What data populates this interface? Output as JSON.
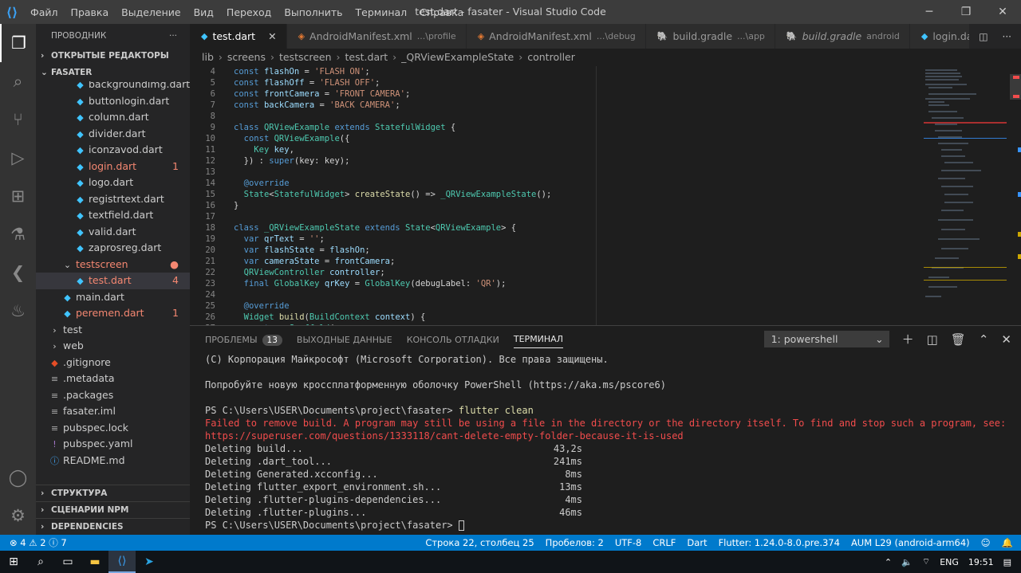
{
  "titlebar": {
    "menu": [
      "Файл",
      "Правка",
      "Выделение",
      "Вид",
      "Переход",
      "Выполнить",
      "Терминал",
      "Справка"
    ],
    "title": "test.dart - fasater - Visual Studio Code"
  },
  "sidebar": {
    "title": "ПРОВОДНИК",
    "open_editors": "ОТКРЫТЫЕ РЕДАКТОРЫ",
    "project": "FASATER",
    "files": [
      {
        "name": "backgroundimg.dart",
        "indent": 2,
        "icon": "dart",
        "err": false,
        "badge": ""
      },
      {
        "name": "buttonlogin.dart",
        "indent": 2,
        "icon": "dart",
        "err": false,
        "badge": ""
      },
      {
        "name": "column.dart",
        "indent": 2,
        "icon": "dart",
        "err": false,
        "badge": ""
      },
      {
        "name": "divider.dart",
        "indent": 2,
        "icon": "dart",
        "err": false,
        "badge": ""
      },
      {
        "name": "iconzavod.dart",
        "indent": 2,
        "icon": "dart",
        "err": false,
        "badge": ""
      },
      {
        "name": "login.dart",
        "indent": 2,
        "icon": "dart",
        "err": true,
        "badge": "1"
      },
      {
        "name": "logo.dart",
        "indent": 2,
        "icon": "dart",
        "err": false,
        "badge": ""
      },
      {
        "name": "registrtext.dart",
        "indent": 2,
        "icon": "dart",
        "err": false,
        "badge": ""
      },
      {
        "name": "textfield.dart",
        "indent": 2,
        "icon": "dart",
        "err": false,
        "badge": ""
      },
      {
        "name": "valid.dart",
        "indent": 2,
        "icon": "dart",
        "err": false,
        "badge": ""
      },
      {
        "name": "zaprosreg.dart",
        "indent": 2,
        "icon": "dart",
        "err": false,
        "badge": ""
      },
      {
        "name": "testscreen",
        "indent": 1,
        "icon": "folder-open",
        "err": true,
        "badge": "●"
      },
      {
        "name": "test.dart",
        "indent": 2,
        "icon": "dart",
        "err": true,
        "badge": "4"
      },
      {
        "name": "main.dart",
        "indent": 1,
        "icon": "dart",
        "err": false,
        "badge": ""
      },
      {
        "name": "peremen.dart",
        "indent": 1,
        "icon": "dart",
        "err": true,
        "badge": "1"
      },
      {
        "name": "test",
        "indent": 0,
        "icon": "folder",
        "err": false,
        "badge": ""
      },
      {
        "name": "web",
        "indent": 0,
        "icon": "folder",
        "err": false,
        "badge": ""
      },
      {
        "name": ".gitignore",
        "indent": 0,
        "icon": "git",
        "err": false,
        "badge": ""
      },
      {
        "name": ".metadata",
        "indent": 0,
        "icon": "text",
        "err": false,
        "badge": ""
      },
      {
        "name": ".packages",
        "indent": 0,
        "icon": "text",
        "err": false,
        "badge": ""
      },
      {
        "name": "fasater.iml",
        "indent": 0,
        "icon": "text",
        "err": false,
        "badge": ""
      },
      {
        "name": "pubspec.lock",
        "indent": 0,
        "icon": "text",
        "err": false,
        "badge": ""
      },
      {
        "name": "pubspec.yaml",
        "indent": 0,
        "icon": "yaml",
        "err": false,
        "badge": ""
      },
      {
        "name": "README.md",
        "indent": 0,
        "icon": "info",
        "err": false,
        "badge": ""
      }
    ],
    "bottom_sections": [
      "СТРУКТУРА",
      "СЦЕНАРИИ NPM",
      "DEPENDENCIES"
    ]
  },
  "tabs": [
    {
      "label": "test.dart",
      "sub": "",
      "active": true,
      "italic": false,
      "icon": "dart"
    },
    {
      "label": "AndroidManifest.xml",
      "sub": "...\\profile",
      "active": false,
      "italic": false,
      "icon": "xml"
    },
    {
      "label": "AndroidManifest.xml",
      "sub": "...\\debug",
      "active": false,
      "italic": false,
      "icon": "xml"
    },
    {
      "label": "build.gradle",
      "sub": "...\\app",
      "active": false,
      "italic": false,
      "icon": "gradle"
    },
    {
      "label": "build.gradle",
      "sub": "android",
      "active": false,
      "italic": true,
      "icon": "gradle"
    },
    {
      "label": "login.dart",
      "sub": "",
      "active": false,
      "italic": false,
      "icon": "dart"
    }
  ],
  "breadcrumbs": [
    "lib",
    "screens",
    "testscreen",
    "test.dart",
    "_QRViewExampleState",
    "controller"
  ],
  "code": [
    {
      "n": "4",
      "html": "<span class='k'>const</span> <span class='v'>flashOn</span> = <span class='s'>'FLASH ON'</span>;"
    },
    {
      "n": "5",
      "html": "<span class='k'>const</span> <span class='v'>flashOff</span> = <span class='s'>'FLASH OFF'</span>;"
    },
    {
      "n": "6",
      "html": "<span class='k'>const</span> <span class='v'>frontCamera</span> = <span class='s'>'FRONT CAMERA'</span>;"
    },
    {
      "n": "7",
      "html": "<span class='k'>const</span> <span class='v'>backCamera</span> = <span class='s'>'BACK CAMERA'</span>;"
    },
    {
      "n": "8",
      "html": ""
    },
    {
      "n": "9",
      "html": "<span class='k'>class</span> <span class='c'>QRViewExample</span> <span class='k'>extends</span> <span class='c'>StatefulWidget</span> {"
    },
    {
      "n": "10",
      "html": "  <span class='k'>const</span> <span class='c'>QRViewExample</span>({"
    },
    {
      "n": "11",
      "html": "    <span class='c'>Key</span> <span class='v'>key</span>,"
    },
    {
      "n": "12",
      "html": "  }) : <span class='k'>super</span>(key: key);"
    },
    {
      "n": "13",
      "html": ""
    },
    {
      "n": "14",
      "html": "  <span class='an'>@override</span>"
    },
    {
      "n": "15",
      "html": "  <span class='c'>State</span>&lt;<span class='c'>StatefulWidget</span>&gt; <span class='f'>createState</span>() =&gt; <span class='c'>_QRViewExampleState</span>();"
    },
    {
      "n": "16",
      "html": "}"
    },
    {
      "n": "17",
      "html": ""
    },
    {
      "n": "18",
      "html": "<span class='k'>class</span> <span class='c'>_QRViewExampleState</span> <span class='k'>extends</span> <span class='c'>State</span>&lt;<span class='c'>QRViewExample</span>&gt; {"
    },
    {
      "n": "19",
      "html": "  <span class='k'>var</span> <span class='v'>qrText</span> = <span class='s'>''</span>;"
    },
    {
      "n": "20",
      "html": "  <span class='k'>var</span> <span class='v'>flashState</span> = <span class='v'>flashOn</span>;"
    },
    {
      "n": "21",
      "html": "  <span class='k'>var</span> <span class='v'>cameraState</span> = <span class='v'>frontCamera</span>;"
    },
    {
      "n": "22",
      "html": "  <span class='c'>QRViewController</span> <span class='v'>controller</span>;"
    },
    {
      "n": "23",
      "html": "  <span class='k'>final</span> <span class='c'>GlobalKey</span> <span class='v'>qrKey</span> = <span class='c'>GlobalKey</span>(debugLabel: <span class='s'>'QR'</span>);"
    },
    {
      "n": "24",
      "html": ""
    },
    {
      "n": "25",
      "html": "  <span class='an'>@override</span>"
    },
    {
      "n": "26",
      "html": "  <span class='c'>Widget</span> <span class='f'>build</span>(<span class='c'>BuildContext</span> <span class='v'>context</span>) {"
    },
    {
      "n": "27",
      "html": "    <span class='k'>return</span> <span class='c'>Scaffold</span>("
    }
  ],
  "panel": {
    "tabs": [
      "ПРОБЛЕМЫ",
      "ВЫХОДНЫЕ ДАННЫЕ",
      "КОНСОЛЬ ОТЛАДКИ",
      "ТЕРМИНАЛ"
    ],
    "problems_count": "13",
    "terminal_select": "1: powershell"
  },
  "terminal": {
    "copyright": "(C) Корпорация Майкрософт (Microsoft Corporation). Все права защищены.",
    "hint": "Попробуйте новую кроссплатформенную оболочку PowerShell (https://aka.ms/pscore6)",
    "prompt": "PS C:\\Users\\USER\\Documents\\project\\fasater> ",
    "command": "flutter clean",
    "error1": "Failed to remove build. A program may still be using a file in the directory or the directory itself. To find and stop such a program, see:",
    "error2": "https://superuser.com/questions/1333118/cant-delete-empty-folder-because-it-is-used",
    "deletes": [
      {
        "name": "Deleting build...",
        "time": "43,2s"
      },
      {
        "name": "Deleting .dart_tool...",
        "time": "241ms"
      },
      {
        "name": "Deleting Generated.xcconfig...",
        "time": "8ms"
      },
      {
        "name": "Deleting flutter_export_environment.sh...",
        "time": "13ms"
      },
      {
        "name": "Deleting .flutter-plugins-dependencies...",
        "time": "4ms"
      },
      {
        "name": "Deleting .flutter-plugins...",
        "time": "46ms"
      }
    ],
    "final_prompt": "PS C:\\Users\\USER\\Documents\\project\\fasater> "
  },
  "status": {
    "errors": "4",
    "warnings": "2",
    "infos": "7",
    "position": "Строка 22, столбец 25",
    "spaces": "Пробелов: 2",
    "encoding": "UTF-8",
    "eol": "CRLF",
    "language": "Dart",
    "flutter": "Flutter: 1.24.0-8.0.pre.374",
    "device": "AUM L29 (android-arm64)"
  },
  "taskbar": {
    "lang": "ENG",
    "time": "19:51"
  }
}
